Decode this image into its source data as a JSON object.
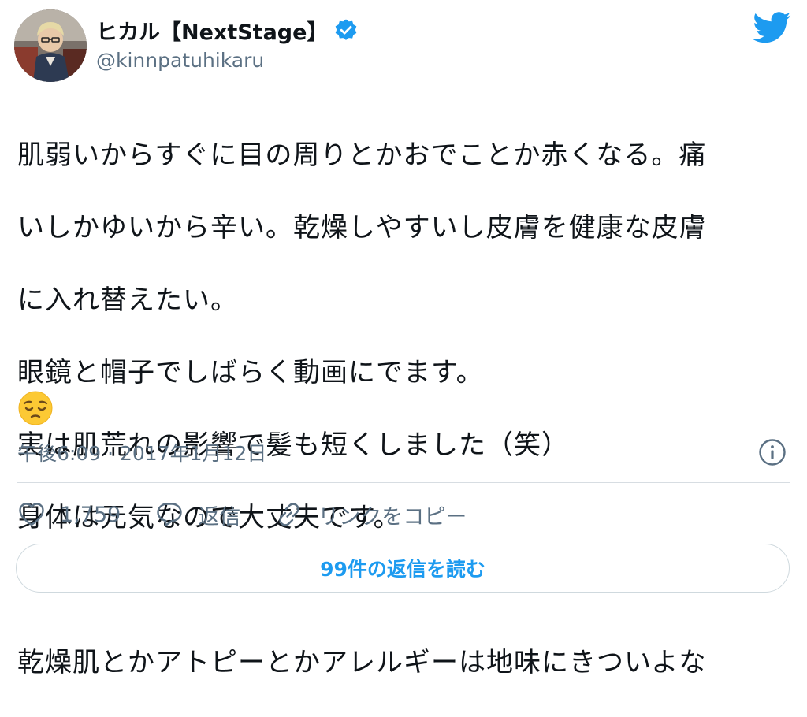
{
  "user": {
    "display_name": "ヒカル【NextStage】",
    "handle": "@kinnpatuhikaru",
    "verified": true
  },
  "tweet": {
    "lines": [
      "肌弱いからすぐに目の周りとかおでことか赤くなる。痛",
      "いしかゆいから辛い。乾燥しやすいし皮膚を健康な皮膚",
      "に入れ替えたい。",
      "眼鏡と帽子でしばらく動画にでます。",
      "実は肌荒れの影響で髪も短くしました（笑）",
      "身体は元気なので大丈夫です。",
      "",
      "乾燥肌とかアトピーとかアレルギーは地味にきついよな"
    ],
    "emoji": "pensive-face",
    "timestamp": "午後6:09 · 2017年1月12日"
  },
  "actions": {
    "like_count": "1,759",
    "reply_label": "返信",
    "copy_link_label": "リンクをコピー"
  },
  "replies_button": {
    "label": "99件の返信を読む"
  },
  "icons": {
    "bird": "twitter-bird-icon",
    "verified": "verified-badge-icon",
    "info": "info-icon",
    "like": "heart-icon",
    "reply": "speech-bubble-icon",
    "link": "link-icon"
  },
  "colors": {
    "accent": "#1d9bf0",
    "secondary_text": "#5b7083",
    "divider": "#d7dde2"
  }
}
